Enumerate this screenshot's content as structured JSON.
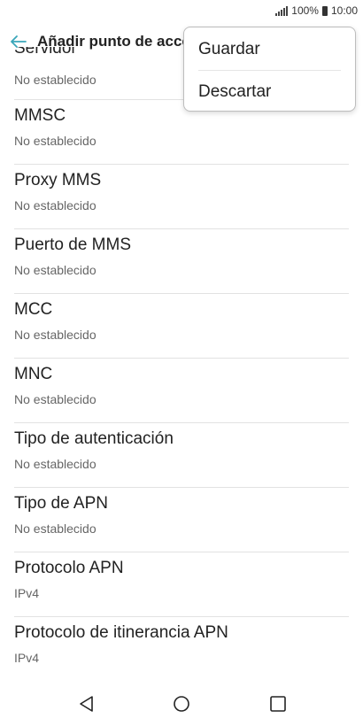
{
  "status": {
    "battery_percent": "100%",
    "time": "10:00"
  },
  "header": {
    "title": "Añadir punto de acceso"
  },
  "menu": {
    "items": [
      "Guardar",
      "Descartar"
    ]
  },
  "settings": [
    {
      "title": "Servidor",
      "value": "No establecido"
    },
    {
      "title": "MMSC",
      "value": "No establecido"
    },
    {
      "title": "Proxy MMS",
      "value": "No establecido"
    },
    {
      "title": "Puerto de MMS",
      "value": "No establecido"
    },
    {
      "title": "MCC",
      "value": "No establecido"
    },
    {
      "title": "MNC",
      "value": "No establecido"
    },
    {
      "title": "Tipo de autenticación",
      "value": "No establecido"
    },
    {
      "title": "Tipo de APN",
      "value": "No establecido"
    },
    {
      "title": "Protocolo APN",
      "value": "IPv4"
    },
    {
      "title": "Protocolo de itinerancia APN",
      "value": "IPv4"
    }
  ],
  "icons": {
    "back": "back-arrow-icon",
    "signal": "signal-icon",
    "battery": "battery-icon",
    "nav_back": "triangle-back-icon",
    "nav_home": "circle-home-icon",
    "nav_recents": "square-recents-icon"
  },
  "colors": {
    "accent": "#3aa6b9",
    "divider": "#e2e2e2"
  }
}
